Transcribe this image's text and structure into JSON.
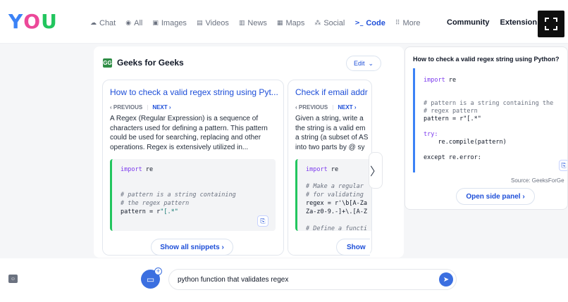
{
  "brand": {
    "logo_y": "Y",
    "logo_o": "O",
    "logo_u": "U",
    "logo_sup": ""
  },
  "nav": [
    {
      "icon": "chat-icon",
      "glyph": "☁",
      "label": "Chat"
    },
    {
      "icon": "all-icon",
      "glyph": "◉",
      "label": "All"
    },
    {
      "icon": "images-icon",
      "glyph": "▣",
      "label": "Images"
    },
    {
      "icon": "videos-icon",
      "glyph": "▤",
      "label": "Videos"
    },
    {
      "icon": "news-icon",
      "glyph": "▥",
      "label": "News"
    },
    {
      "icon": "maps-icon",
      "glyph": "▦",
      "label": "Maps"
    },
    {
      "icon": "social-icon",
      "glyph": "⁂",
      "label": "Social"
    },
    {
      "icon": "code-icon",
      "glyph": ">_",
      "label": "Code"
    },
    {
      "icon": "more-icon",
      "glyph": "⠿",
      "label": "More"
    }
  ],
  "nav_active": "Code",
  "header_links": {
    "community": "Community",
    "extension": "Extension"
  },
  "source": {
    "name": "Geeks for Geeks",
    "icon_text": "GG",
    "edit_label": "Edit"
  },
  "cards": [
    {
      "title": "How to check a valid regex string using Pyt...",
      "prev": "PREVIOUS",
      "next": "NEXT",
      "description": "A Regex (Regular Expression) is a sequence of characters used for defining a pattern. This pattern could be used for searching, replacing and other operations. Regex is extensively utilized in...",
      "show_label": "Show all snippets"
    },
    {
      "title": "Check if email addr",
      "prev": "PREVIOUS",
      "next": "NEXT",
      "description": "Given a string, write a the string is a valid em a string (a subset of AS into two parts by @ sy",
      "show_label": "Show"
    }
  ],
  "side_panel": {
    "question": "How to check a valid regex string using Python?",
    "source": "Source: GeeksForGe",
    "open_label": "Open side panel"
  },
  "search": {
    "value": "python function that validates regex"
  },
  "colors": {
    "accent": "#1d4ed8",
    "gfg_green": "#2f8d46",
    "code_border": "#22c55e"
  }
}
